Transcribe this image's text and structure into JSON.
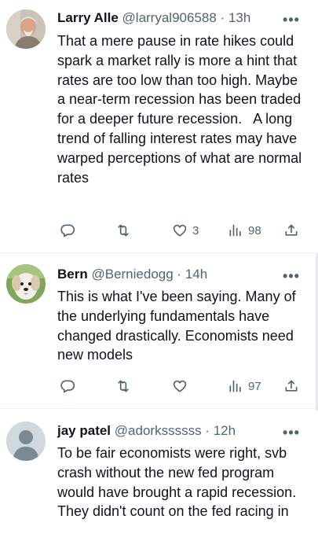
{
  "tweets": [
    {
      "name": "Larry Alle",
      "handle": "@larryal906588",
      "separator": "·",
      "time": "13h",
      "body": "That a mere pause in rate hikes could spark a market rally is more a hint that rates are too low than too high. Maybe a near-term recession has been traded for a deeper future recession.   A long trend of falling interest rates may have warped perceptions of what are normal rates",
      "likes": "3",
      "views": "98",
      "avatar": "person-photo"
    },
    {
      "name": "Bern",
      "handle": "@Berniedogg",
      "separator": "·",
      "time": "14h",
      "body": "This is what I've been saying. Many of the underlying fundamentals have changed drastically. Economists need new models",
      "likes": "",
      "views": "97",
      "avatar": "dog-photo"
    },
    {
      "name": "jay patel",
      "handle": "@adorkssssss",
      "separator": "·",
      "time": "12h",
      "body": "To be fair economists were right, svb crash without the new fed program would have brought a rapid recession. They didn't count on the fed racing in",
      "avatar": "default-avatar"
    }
  ],
  "more_glyph": "•••",
  "colors": {
    "text": "#0f1419",
    "muted": "#536471",
    "divider": "#eff3f4"
  },
  "icons": [
    "reply-icon",
    "retweet-icon",
    "like-icon",
    "views-icon",
    "share-icon"
  ]
}
